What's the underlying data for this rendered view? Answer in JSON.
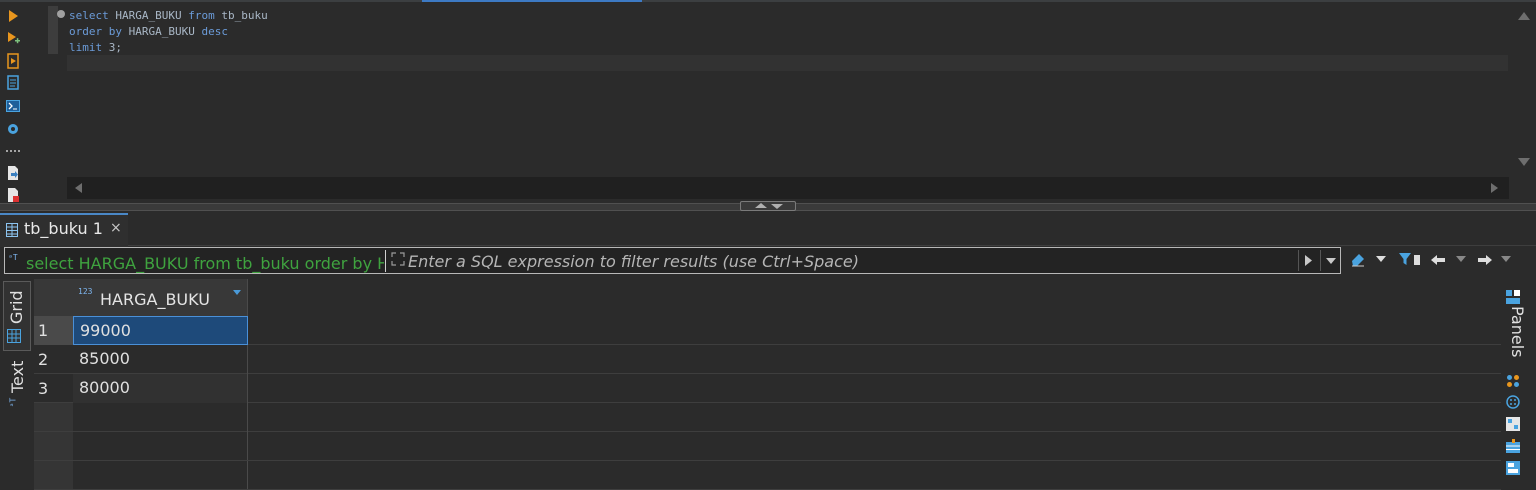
{
  "editor": {
    "lines": [
      {
        "kw1": "select",
        "t1": " HARGA_BUKU ",
        "kw2": "from",
        "t2": " tb_buku"
      },
      {
        "kw1": "order by",
        "t1": " HARGA_BUKU ",
        "kw2": "desc",
        "t2": ""
      },
      {
        "kw1": "limit",
        "t1": " 3;",
        "kw2": "",
        "t2": ""
      }
    ]
  },
  "results": {
    "tab_label": "tb_buku 1",
    "tab_close": "×",
    "filter_sql": "select HARGA_BUKU from tb_buku order by H",
    "filter_placeholder": "Enter a SQL expression to filter results (use Ctrl+Space)",
    "side_tabs": {
      "grid": "Grid",
      "text": "Text"
    },
    "panels_label": "Panels",
    "column_type_icon": "123",
    "columns": [
      "HARGA_BUKU"
    ],
    "rows": [
      {
        "num": "1",
        "value": "99000"
      },
      {
        "num": "2",
        "value": "85000"
      },
      {
        "num": "3",
        "value": "80000"
      }
    ]
  },
  "colors": {
    "accent": "#4a88c7",
    "keyword": "#6b9bd8",
    "filter_sql": "#3fa33f",
    "selected_cell": "#1e4a7a"
  },
  "icons": {
    "left_toolbar": [
      "run-statement-icon",
      "run-in-new-tab-icon",
      "execute-script-icon",
      "explain-plan-icon",
      "console-icon",
      "settings-icon",
      "more-icon",
      "export-icon",
      "load-script-icon"
    ],
    "filter_toolbar": [
      "eraser-icon",
      "filter-icon",
      "back-icon",
      "forward-icon"
    ],
    "right_panel": [
      "panels-icon",
      "palette-icon",
      "grid-settings-icon",
      "calc-icon",
      "export-panel-icon"
    ]
  }
}
